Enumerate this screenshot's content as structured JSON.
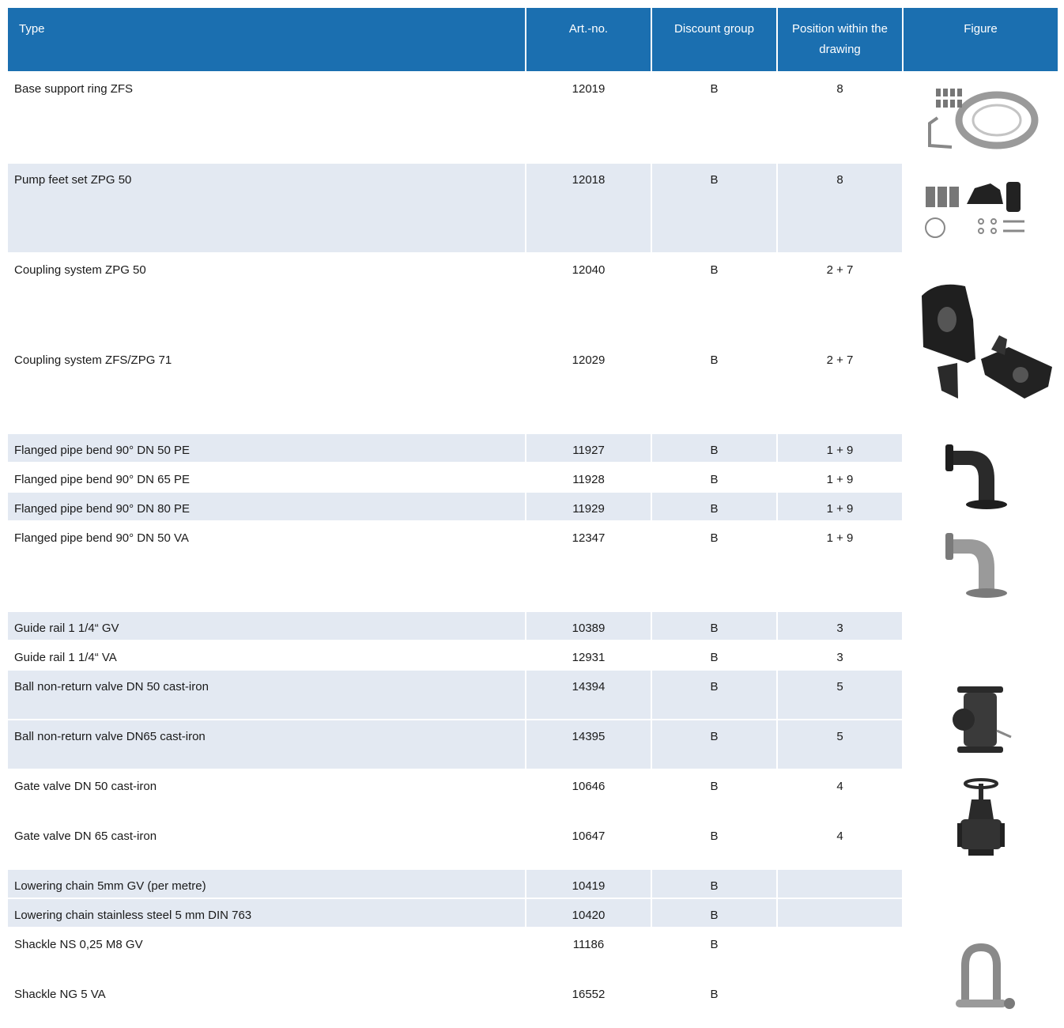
{
  "header": {
    "type": "Type",
    "art_no": "Art.-no.",
    "discount_group": "Discount group",
    "position": "Position within the drawing",
    "figure": "Figure"
  },
  "rows": [
    {
      "type": "Base support ring ZFS",
      "art": "12019",
      "group": "B",
      "pos": "8",
      "figure": "base-support-ring-image"
    },
    {
      "type": "Pump feet set ZPG 50",
      "art": "12018",
      "group": "B",
      "pos": "8",
      "figure": "pump-feet-set-image"
    },
    {
      "type": "Coupling system ZPG 50",
      "art": "12040",
      "group": "B",
      "pos": "2 + 7",
      "figure": "coupling-system-image"
    },
    {
      "type": "Coupling system ZFS/ZPG 71",
      "art": "12029",
      "group": "B",
      "pos": "2 + 7"
    },
    {
      "type": "Flanged pipe bend 90° DN 50 PE",
      "art": "11927",
      "group": "B",
      "pos": "1 + 9",
      "figure": "pipe-bend-pe-image"
    },
    {
      "type": "Flanged pipe bend 90° DN 65 PE",
      "art": "11928",
      "group": "B",
      "pos": "1 + 9"
    },
    {
      "type": "Flanged pipe bend 90° DN 80 PE",
      "art": "11929",
      "group": "B",
      "pos": "1 + 9"
    },
    {
      "type": "Flanged pipe bend 90° DN 50 VA",
      "art": "12347",
      "group": "B",
      "pos": "1 + 9",
      "figure": "pipe-bend-va-image"
    },
    {
      "type": "Guide rail 1 1/4“ GV",
      "art": "10389",
      "group": "B",
      "pos": "3"
    },
    {
      "type": "Guide rail 1 1/4“ VA",
      "art": "12931",
      "group": "B",
      "pos": "3"
    },
    {
      "type": "Ball non-return valve DN 50 cast-iron",
      "art": "14394",
      "group": "B",
      "pos": "5",
      "figure": "ball-valve-image"
    },
    {
      "type": "Ball non-return valve DN65 cast-iron",
      "art": "14395",
      "group": "B",
      "pos": "5"
    },
    {
      "type": "Gate valve DN 50 cast-iron",
      "art": "10646",
      "group": "B",
      "pos": "4",
      "figure": "gate-valve-image"
    },
    {
      "type": "Gate valve DN 65 cast-iron",
      "art": "10647",
      "group": "B",
      "pos": "4"
    },
    {
      "type": "Lowering chain 5mm GV (per metre)",
      "art": "10419",
      "group": "B",
      "pos": ""
    },
    {
      "type": "Lowering chain stainless steel 5 mm DIN 763",
      "art": "10420",
      "group": "B",
      "pos": ""
    },
    {
      "type": "Shackle NS 0,25 M8 GV",
      "art": "11186",
      "group": "B",
      "pos": "",
      "figure": "shackle-image"
    },
    {
      "type": "Shackle NG 5 VA",
      "art": "16552",
      "group": "B",
      "pos": ""
    }
  ]
}
